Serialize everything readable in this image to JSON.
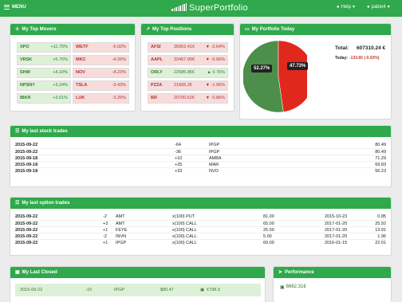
{
  "topbar": {
    "menu_label": "MENU",
    "brand": "SuperPortfolio",
    "help_label": "Help",
    "user_label": "pablo4"
  },
  "movers": {
    "title": "My Top Movers",
    "gainers": [
      {
        "sym": "XPO",
        "chg": "+11.75%"
      },
      {
        "sym": "VRSK",
        "chg": "+5.75%"
      },
      {
        "sym": "SHW",
        "chg": "+4.10%"
      },
      {
        "sym": "NPSNY",
        "chg": "+3.24%"
      },
      {
        "sym": "IBKR",
        "chg": "+3.01%"
      }
    ],
    "losers": [
      {
        "sym": "WETF",
        "chg": "-5.02%"
      },
      {
        "sym": "MKC",
        "chg": "-4.26%"
      },
      {
        "sym": "NOV",
        "chg": "-4.23%"
      },
      {
        "sym": "TSLA",
        "chg": "-3.43%"
      },
      {
        "sym": "LUK",
        "chg": "-3.26%"
      }
    ]
  },
  "positions": {
    "title": "My Top Positions",
    "rows": [
      {
        "sym": "AFSI",
        "val": "35902.41€",
        "chg": "▼ -2.64%",
        "up": false
      },
      {
        "sym": "AAPL",
        "val": "33457.99€",
        "chg": "▼ -0.66%",
        "up": false
      },
      {
        "sym": "ORLY",
        "val": "22585.85€",
        "chg": "▲ 0.76%",
        "up": true
      },
      {
        "sym": "PZZA",
        "val": "21665.2€",
        "chg": "▼ -1.06%",
        "up": false
      },
      {
        "sym": "BR",
        "val": "20700.62€",
        "chg": "▼ -0.86%",
        "up": false
      }
    ]
  },
  "today": {
    "title": "My Portfolio Today",
    "total_label": "Total:",
    "total_value": "607310.24 €",
    "today_label": "Today:",
    "today_value": "-133.65 (-0.02%)",
    "pie": [
      {
        "label": "52.27%",
        "value": 52.27,
        "color": "#4c8f4a"
      },
      {
        "label": "47.73%",
        "value": 47.73,
        "color": "#e0281d"
      }
    ]
  },
  "stock_trades": {
    "title": "My last stock trades",
    "rows": [
      {
        "date": "2015-09-22",
        "qty": "-64",
        "sym": "IPGP",
        "price": "80.49"
      },
      {
        "date": "2015-09-22",
        "qty": "-36",
        "sym": "IPGP",
        "price": "80.49"
      },
      {
        "date": "2015-09-18",
        "qty": "+10",
        "sym": "AMBA",
        "price": "71.29"
      },
      {
        "date": "2015-09-18",
        "qty": "+25",
        "sym": "MAR",
        "price": "69.83"
      },
      {
        "date": "2015-09-18",
        "qty": "+33",
        "sym": "NVO",
        "price": "56.23"
      }
    ]
  },
  "option_trades": {
    "title": "My last option trades",
    "rows": [
      {
        "date": "2015-09-22",
        "qty": "-2",
        "sym": "AMT",
        "type": "x(100) PUT",
        "strike": "81.00",
        "exp": "2015-10-23",
        "price": "0.85"
      },
      {
        "date": "2015-09-22",
        "qty": "+3",
        "sym": "AMT",
        "type": "x(100) CALL",
        "strike": "65.00",
        "exp": "2017-01-20",
        "price": "25.92"
      },
      {
        "date": "2015-09-22",
        "qty": "+1",
        "sym": "FEYE",
        "type": "x(100) CALL",
        "strike": "25.00",
        "exp": "2017-01-20",
        "price": "13.91"
      },
      {
        "date": "2015-09-22",
        "qty": "-2",
        "sym": "INVN",
        "type": "x(100) CALL",
        "strike": "5.00",
        "exp": "2017-01-20",
        "price": "1.96"
      },
      {
        "date": "2015-09-22",
        "qty": "+1",
        "sym": "IPGP",
        "type": "x(100) CALL",
        "strike": "60.00",
        "exp": "2016-01-15",
        "price": "22.01"
      }
    ]
  },
  "closed": {
    "title": "My Last Closed",
    "row": {
      "date": "2015-09-22",
      "qty": "-10",
      "sym": "IPGP",
      "price": "$80.47",
      "gain": "€798.3"
    }
  },
  "performance": {
    "title": "Performance",
    "value": "6662.31€"
  }
}
